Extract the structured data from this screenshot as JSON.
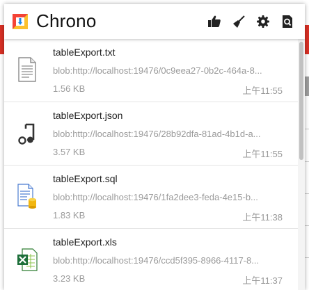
{
  "app": {
    "title": "Chrono"
  },
  "toolbar": {
    "icons": [
      "thumbs-up-icon",
      "broom-icon",
      "gear-icon",
      "search-file-icon"
    ]
  },
  "downloads": [
    {
      "name": "tableExport.txt",
      "url": "blob:http://localhost:19476/0c9eea27-0b2c-464a-8...",
      "size": "1.56 KB",
      "time": "上午11:55",
      "icon": "text-file-icon"
    },
    {
      "name": "tableExport.json",
      "url": "blob:http://localhost:19476/28b92dfa-81ad-4b1d-a...",
      "size": "3.57 KB",
      "time": "上午11:55",
      "icon": "music-note-icon"
    },
    {
      "name": "tableExport.sql",
      "url": "blob:http://localhost:19476/1fa2dee3-feda-4e15-b...",
      "size": "1.83 KB",
      "time": "上午11:38",
      "icon": "database-file-icon"
    },
    {
      "name": "tableExport.xls",
      "url": "blob:http://localhost:19476/ccd5f395-8966-4117-8...",
      "size": "3.23 KB",
      "time": "上午11:37",
      "icon": "excel-file-icon"
    }
  ]
}
